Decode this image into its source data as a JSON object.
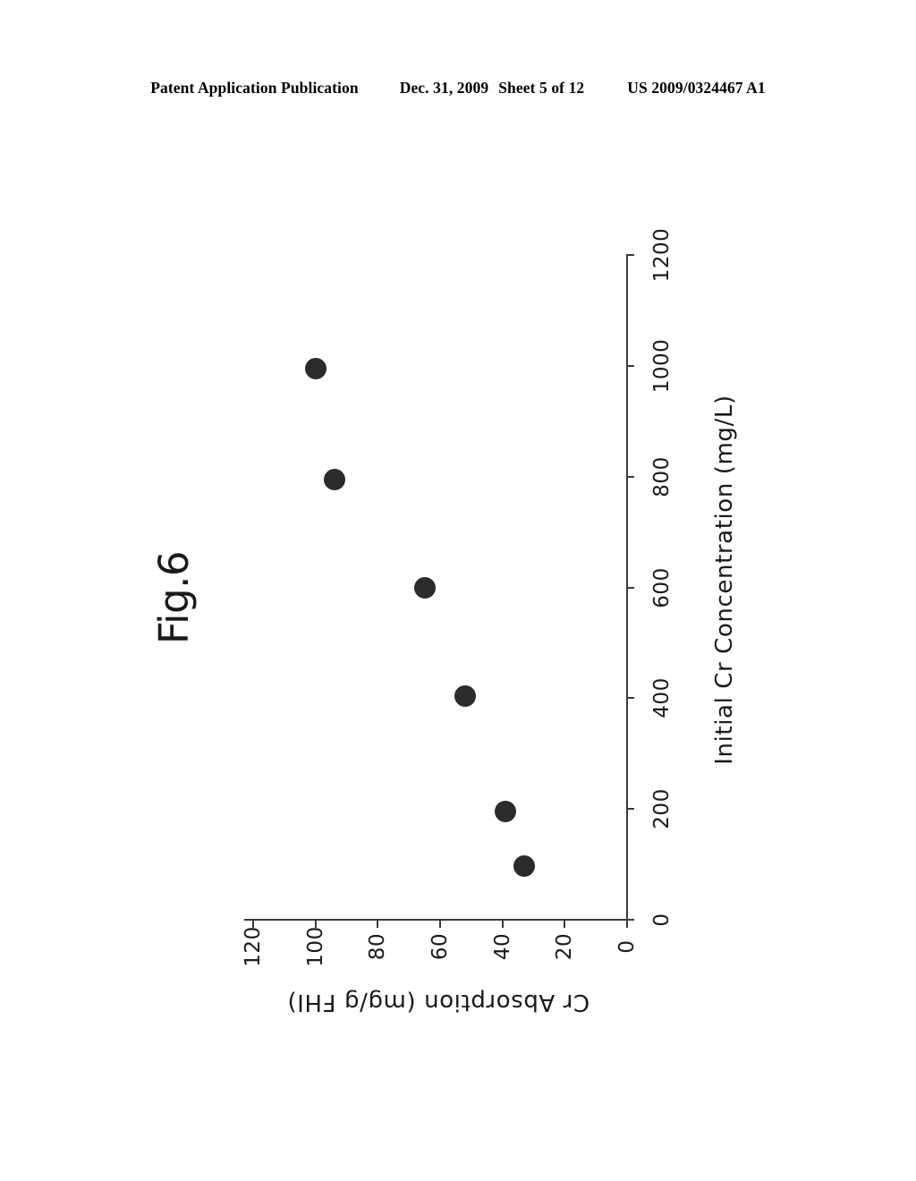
{
  "header": {
    "publication": "Patent Application Publication",
    "date": "Dec. 31, 2009",
    "sheet": "Sheet 5 of 12",
    "number": "US 2009/0324467 A1"
  },
  "figure": {
    "caption": "Fig.6"
  },
  "chart_data": {
    "type": "scatter",
    "title": "Fig.6",
    "xlabel": "Initial Cr Concentration (mg/L)",
    "ylabel": "Cr Absorption (mg/g FHI)",
    "xlim": [
      0,
      1200
    ],
    "ylim": [
      0,
      120
    ],
    "xticks": [
      0,
      200,
      400,
      600,
      800,
      1000,
      1200
    ],
    "yticks": [
      0,
      20,
      40,
      60,
      80,
      100,
      120
    ],
    "xtick_labels": [
      "0",
      "200",
      "400",
      "600",
      "800",
      "1000",
      "1200"
    ],
    "ytick_labels": [
      "0",
      "20",
      "40",
      "60",
      "80",
      "100",
      "120"
    ],
    "grid": false,
    "legend": null,
    "rotation_degrees": 90,
    "marker": "filled-circle",
    "marker_color": "#2b2b2b",
    "x": [
      97,
      195,
      404,
      599,
      795,
      995
    ],
    "y": [
      33,
      39,
      52,
      65,
      94,
      100
    ],
    "points": [
      {
        "x": 97,
        "y": 33
      },
      {
        "x": 195,
        "y": 39
      },
      {
        "x": 404,
        "y": 52
      },
      {
        "x": 599,
        "y": 65
      },
      {
        "x": 795,
        "y": 94
      },
      {
        "x": 995,
        "y": 100
      }
    ]
  }
}
